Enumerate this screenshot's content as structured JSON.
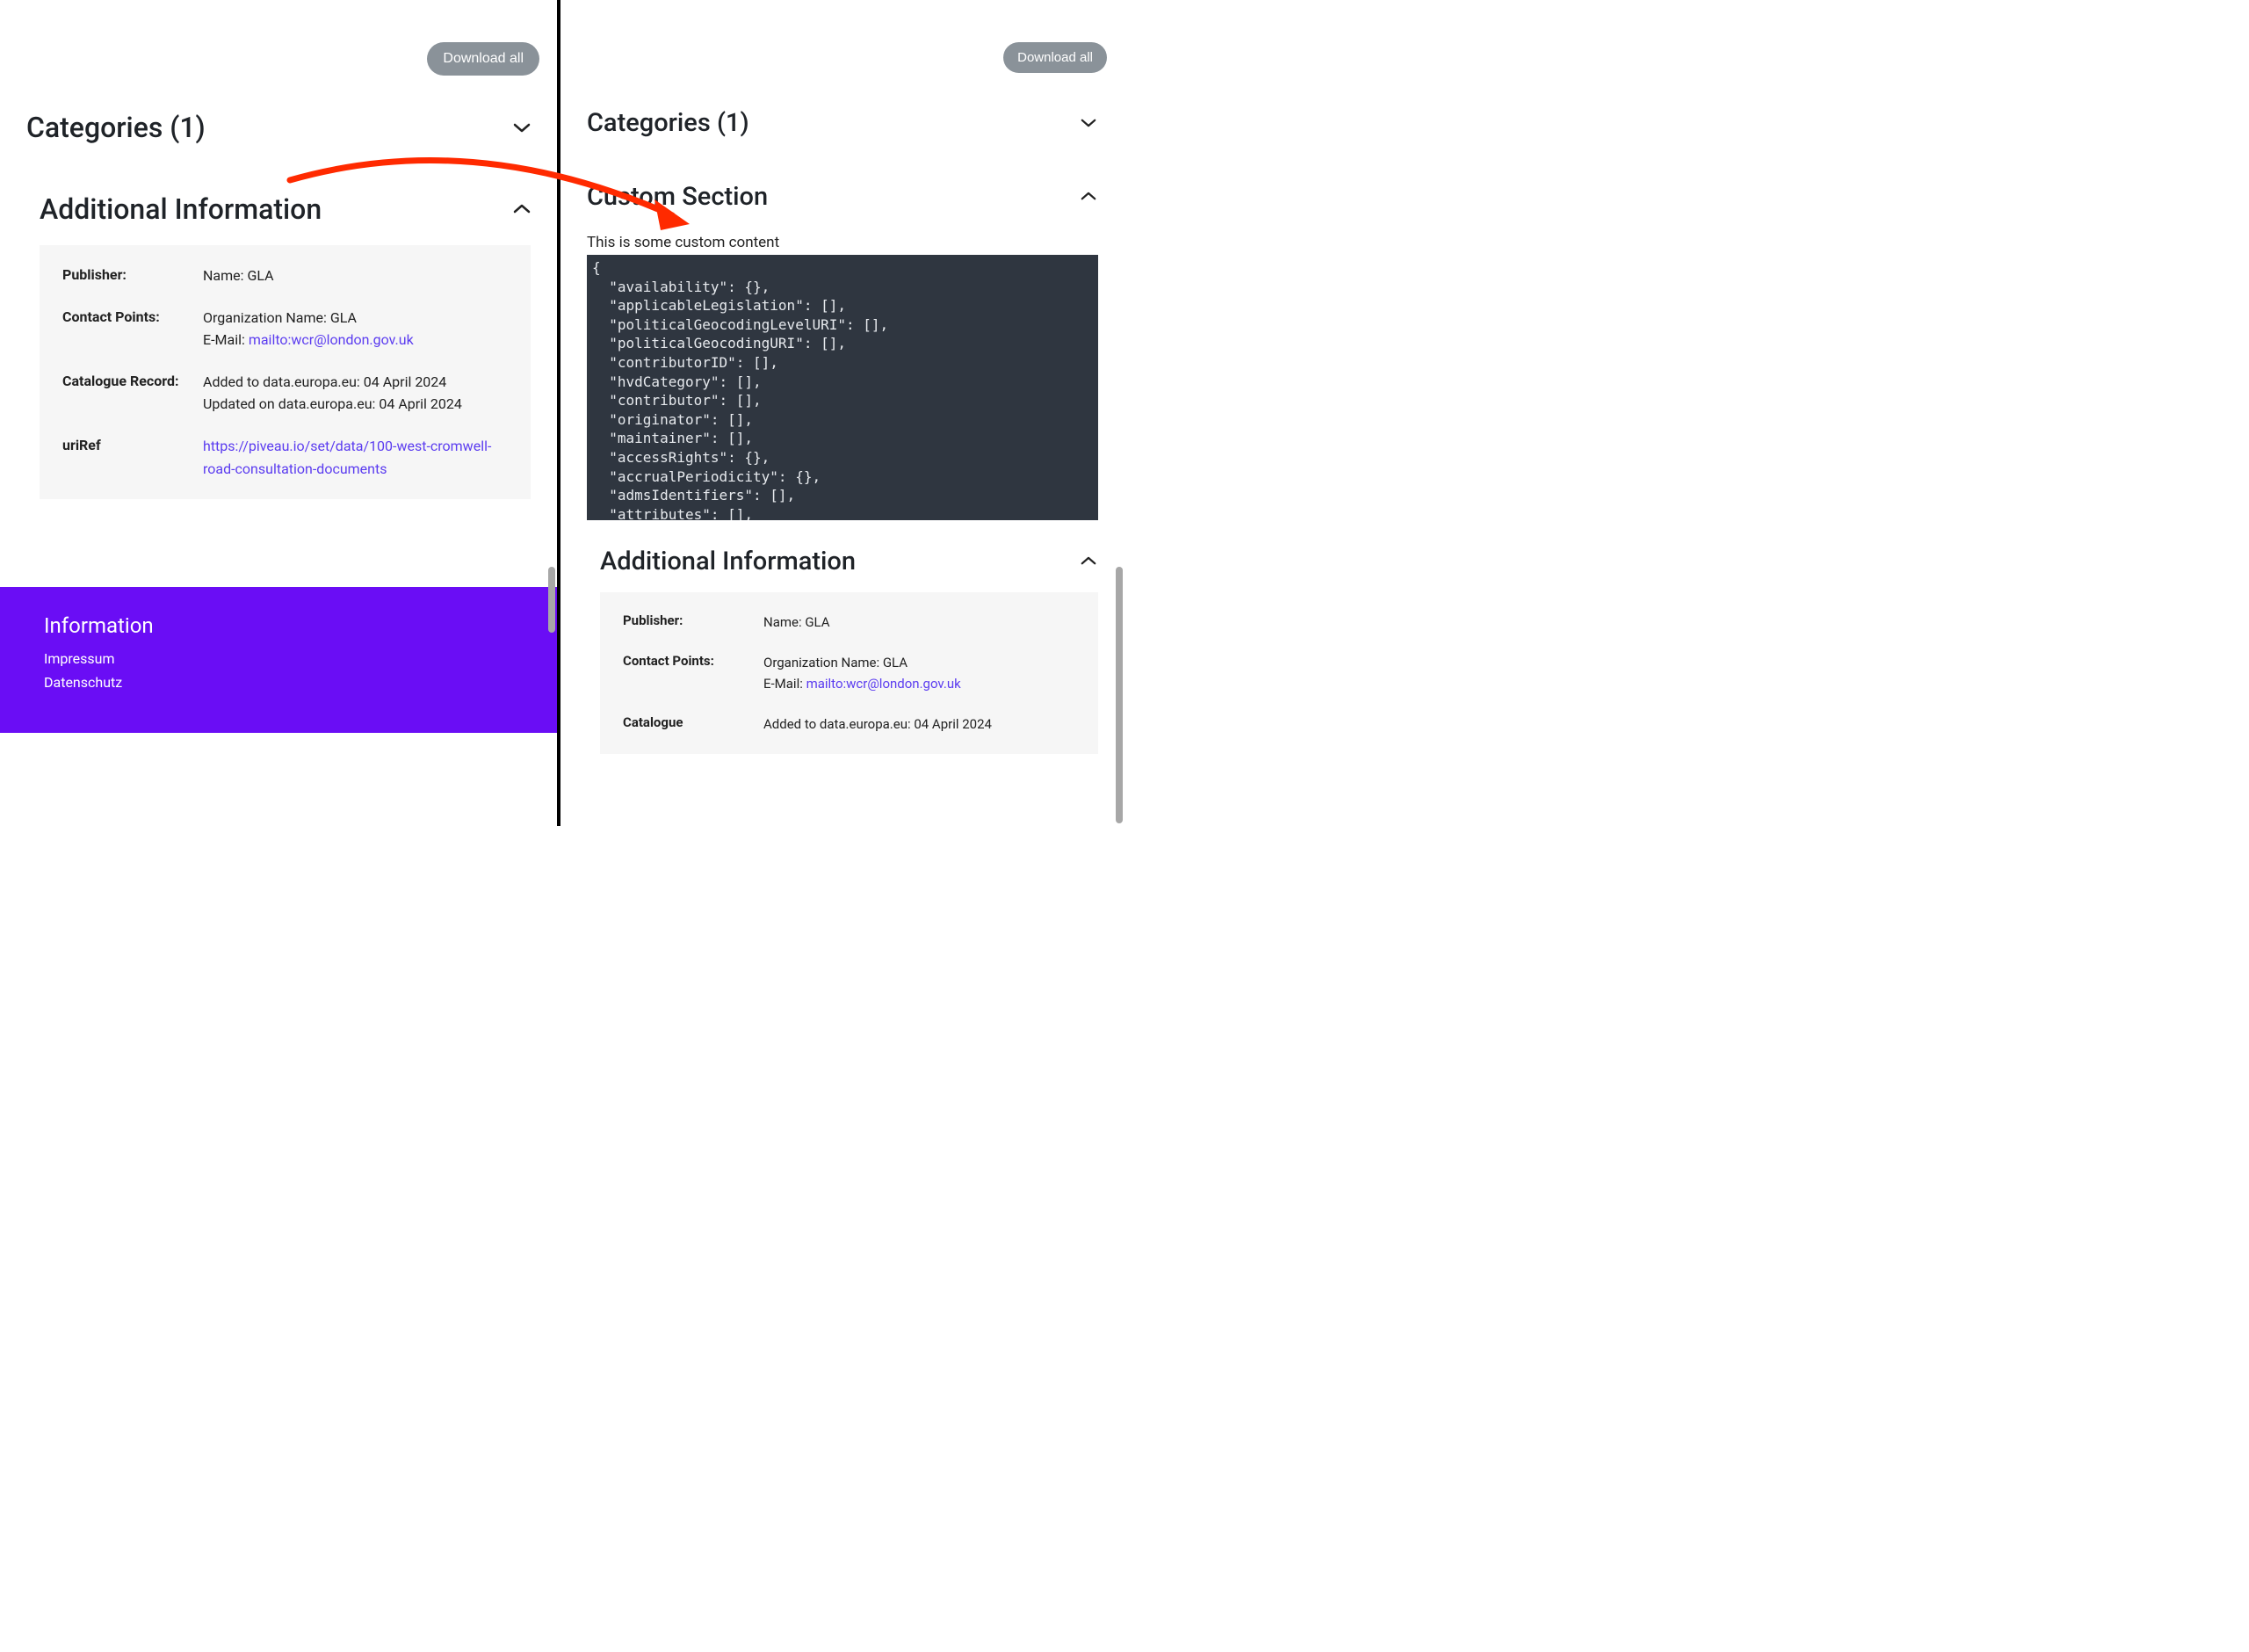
{
  "left": {
    "download_all": "Download all",
    "categories_title": "Categories (1)",
    "additional_info_title": "Additional Information",
    "publisher_label": "Publisher:",
    "publisher_value": "Name: GLA",
    "contact_label": "Contact Points:",
    "contact_org": "Organization Name: GLA",
    "contact_email_prefix": "E-Mail: ",
    "contact_email_link": "mailto:wcr@london.gov.uk",
    "catalogue_label": "Catalogue Record:",
    "catalogue_added": "Added to data.europa.eu: 04 April 2024",
    "catalogue_updated": "Updated on data.europa.eu: 04 April 2024",
    "uriref_label": "uriRef",
    "uriref_link": "https://piveau.io/set/data/100-west-cromwell-road-consultation-documents",
    "footer_title": "Information",
    "footer_impressum": "Impressum",
    "footer_datenschutz": "Datenschutz"
  },
  "right": {
    "download_all": "Download all",
    "categories_title": "Categories (1)",
    "custom_section_title": "Custom Section",
    "custom_desc": "This is some custom content",
    "code_block": "{\n  \"availability\": {},\n  \"applicableLegislation\": [],\n  \"politicalGeocodingLevelURI\": [],\n  \"politicalGeocodingURI\": [],\n  \"contributorID\": [],\n  \"hvdCategory\": [],\n  \"contributor\": [],\n  \"originator\": [],\n  \"maintainer\": [],\n  \"accessRights\": {},\n  \"accrualPeriodicity\": {},\n  \"admsIdentifiers\": [],\n  \"attributes\": [],",
    "additional_info_title": "Additional Information",
    "publisher_label": "Publisher:",
    "publisher_value": "Name: GLA",
    "contact_label": "Contact Points:",
    "contact_org": "Organization Name: GLA",
    "contact_email_prefix": "E-Mail: ",
    "contact_email_link": "mailto:wcr@london.gov.uk",
    "catalogue_label": "Catalogue",
    "catalogue_added": "Added to data.europa.eu: 04 April 2024"
  }
}
